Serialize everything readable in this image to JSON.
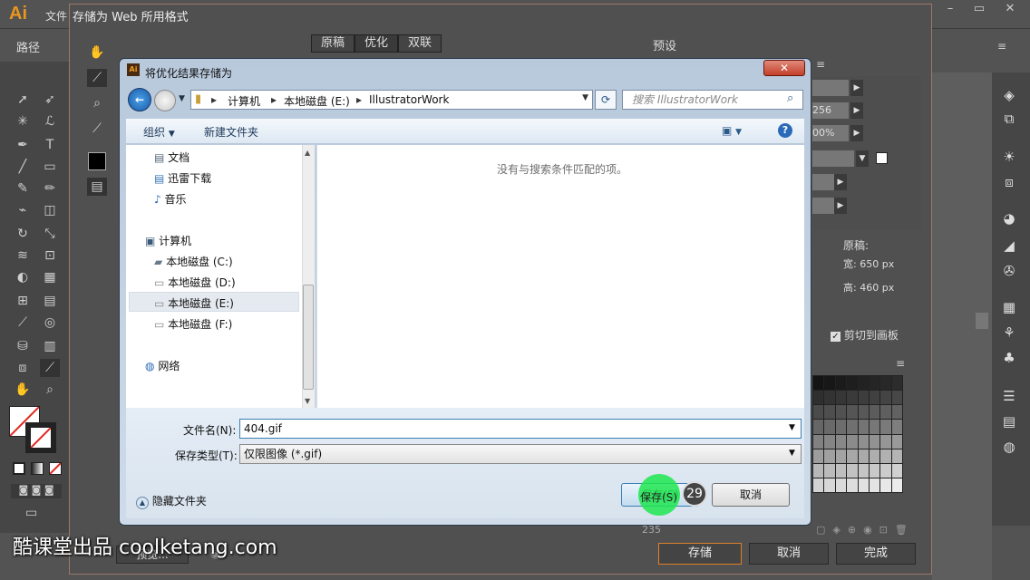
{
  "app": {
    "logo": "Ai",
    "menu_file": "文件",
    "ctrl_label": "路径",
    "win_buttons": [
      "–",
      "▭",
      "✕"
    ]
  },
  "save_for_web": {
    "title": "存储为 Web 所用格式",
    "tabs": [
      "原稿",
      "优化",
      "双联"
    ],
    "active_tab": "优化",
    "preset_label": "预设",
    "preset_menu_icon": "≡",
    "fields": [
      "",
      "256",
      "00%",
      "",
      "",
      ""
    ],
    "image_size": {
      "original_label": "原稿:",
      "width_label": "宽:",
      "width_value": "650 px",
      "height_label": "高:",
      "height_value": "460 px"
    },
    "clip_label": "剪切到画板",
    "clip_checked": true,
    "color_count": "235",
    "preview_button": "预览...",
    "save_button": "存储",
    "cancel_button": "取消",
    "done_button": "完成"
  },
  "dialog": {
    "title": "将优化结果存储为",
    "close_glyph": "✕",
    "breadcrumb": [
      "计算机",
      "本地磁盘 (E:)",
      "IllustratorWork"
    ],
    "search_placeholder": "搜索 IllustratorWork",
    "toolbar_organize": "组织",
    "toolbar_new_folder": "新建文件夹",
    "nav_items": [
      {
        "label": "文档",
        "icon": "document-icon"
      },
      {
        "label": "迅雷下载",
        "icon": "download-icon"
      },
      {
        "label": "音乐",
        "icon": "music-icon"
      },
      {
        "label": "计算机",
        "icon": "computer-icon"
      },
      {
        "label": "本地磁盘 (C:)",
        "icon": "system-drive-icon"
      },
      {
        "label": "本地磁盘 (D:)",
        "icon": "drive-icon"
      },
      {
        "label": "本地磁盘 (E:)",
        "icon": "drive-icon"
      },
      {
        "label": "本地磁盘 (F:)",
        "icon": "drive-icon"
      },
      {
        "label": "网络",
        "icon": "network-icon"
      }
    ],
    "selected_nav": "本地磁盘 (E:)",
    "empty_message": "没有与搜索条件匹配的项。",
    "filename_label": "文件名(N):",
    "filename_value": "404.gif",
    "filetype_label": "保存类型(T):",
    "filetype_value": "仅限图像 (*.gif)",
    "hide_folders": "隐藏文件夹",
    "save_button": "保存(S)",
    "cancel_button": "取消"
  },
  "tutorial": {
    "step_number": "29",
    "watermark": "酷课堂出品 coolketang.com"
  },
  "colors": {
    "ai_bg": "#535353",
    "accent_orange": "#e0802a",
    "highlight_green": "#1ee650",
    "win_blue": "#3c7fb1"
  }
}
